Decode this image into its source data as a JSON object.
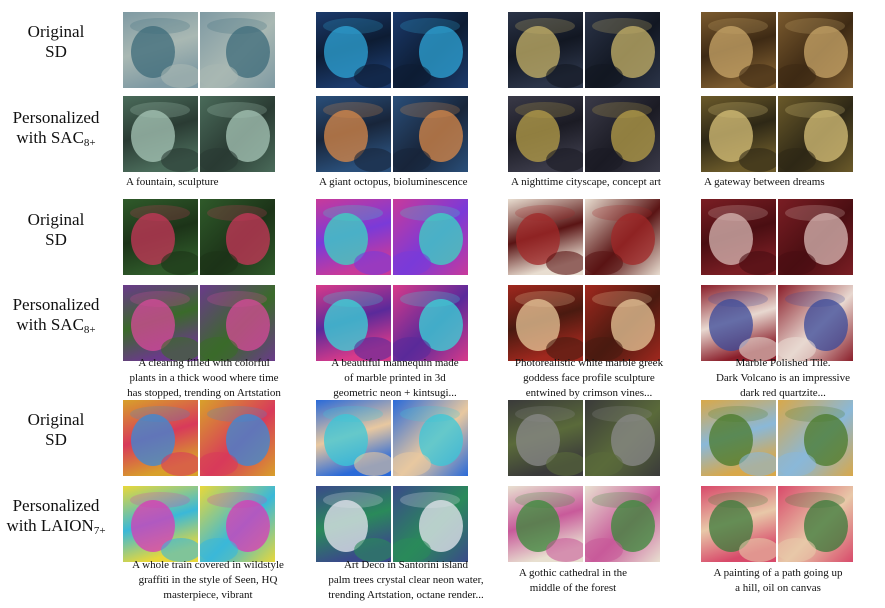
{
  "row_labels": {
    "r1": "Original",
    "r1b": "SD",
    "r2": "Personalized",
    "r2b": "with SAC",
    "r2sub": "8+",
    "r3": "Original",
    "r3b": "SD",
    "r4": "Personalized",
    "r4b": "with SAC",
    "r4sub": "8+",
    "r5": "Original",
    "r5b": "SD",
    "r6": "Personalized",
    "r6b": "with LAION",
    "r6sub": "7+"
  },
  "captions": {
    "g1c1": "A fountain, sculpture",
    "g1c2": "A giant octopus, bioluminescence",
    "g1c3": "A nighttime cityscape, concept art",
    "g1c4": "A gateway between dreams",
    "g2c1": [
      "A clearing filled with colorful",
      "plants in a thick wood where time",
      "has stopped, trending on Artstation"
    ],
    "g2c2": [
      "A beautiful mannequin made",
      "of marble printed in 3d",
      "geometric neon + kintsugi..."
    ],
    "g2c3": [
      "Photorealistic white marble greek",
      "goddess face profile sculpture",
      "entwined by crimson vines..."
    ],
    "g2c4": [
      "Marble Polished Tile.",
      "Dark Volcano is an impressive",
      "dark red quartzite..."
    ],
    "g3c1": [
      "A whole train covered in wildstyle",
      "graffiti in the style of Seen, HQ",
      "masterpiece, vibrant"
    ],
    "g3c2": [
      "Art Deco in Santorini island",
      "palm trees crystal clear neon water,",
      "trending Artstation, octane render..."
    ],
    "g3c3": [
      "A gothic cathedral in the",
      "middle of the forest"
    ],
    "g3c4": [
      "A painting of a path going up",
      "a hill, oil on canvas"
    ]
  },
  "images": [
    {
      "name": "fountain-original",
      "colors": [
        "#7f9aa3",
        "#3d6b7a",
        "#a9b8b3"
      ]
    },
    {
      "name": "octopus-original",
      "colors": [
        "#1b3a6b",
        "#2fa6d8",
        "#0d1c33"
      ]
    },
    {
      "name": "cityscape-original",
      "colors": [
        "#2b3448",
        "#c8b46a",
        "#121722"
      ]
    },
    {
      "name": "gateway-original",
      "colors": [
        "#7a5a2e",
        "#c9a76a",
        "#3e2a14"
      ]
    },
    {
      "name": "fountain-personalized",
      "colors": [
        "#4a6b5a",
        "#a8c7b8",
        "#2a3b33"
      ]
    },
    {
      "name": "octopus-personalized",
      "colors": [
        "#2a4f7a",
        "#d98a4a",
        "#18253a"
      ]
    },
    {
      "name": "cityscape-personalized",
      "colors": [
        "#3a3a48",
        "#b8a04a",
        "#1b1b24"
      ]
    },
    {
      "name": "gateway-personalized",
      "colors": [
        "#6b5a2a",
        "#d8c27a",
        "#2e2816"
      ]
    },
    {
      "name": "clearing-original",
      "colors": [
        "#2f5a2a",
        "#c8375a",
        "#1c3318"
      ]
    },
    {
      "name": "mannequin-original",
      "colors": [
        "#c83a9a",
        "#3ad8c2",
        "#7a3ad8"
      ]
    },
    {
      "name": "marble-goddess-original",
      "colors": [
        "#e8ddd0",
        "#a02828",
        "#5a1414"
      ]
    },
    {
      "name": "tile-original",
      "colors": [
        "#7a1e24",
        "#d8b8b4",
        "#4a0e12"
      ]
    },
    {
      "name": "clearing-personalized",
      "colors": [
        "#6a3a8a",
        "#d84a9a",
        "#3a6a2a"
      ]
    },
    {
      "name": "mannequin-personalized",
      "colors": [
        "#d83a8a",
        "#3ad8d8",
        "#5a2a9a"
      ]
    },
    {
      "name": "marble-goddess-personalized",
      "colors": [
        "#a0281e",
        "#e8c89a",
        "#4a1a10"
      ]
    },
    {
      "name": "tile-personalized",
      "colors": [
        "#8a1e2a",
        "#3a4a9a",
        "#e8d8d0"
      ]
    },
    {
      "name": "train-original",
      "colors": [
        "#d8a02a",
        "#3a8ad8",
        "#d83a5a"
      ]
    },
    {
      "name": "santorini-original",
      "colors": [
        "#2a6ad8",
        "#3ac8d8",
        "#e8c8a0"
      ]
    },
    {
      "name": "cathedral-original",
      "colors": [
        "#3a3a3a",
        "#8a8a8a",
        "#5a6a3a"
      ]
    },
    {
      "name": "path-original",
      "colors": [
        "#d8a84a",
        "#4a7a2a",
        "#8ab8d8"
      ]
    },
    {
      "name": "train-personalized",
      "colors": [
        "#e8d83a",
        "#d83ab8",
        "#3ab8d8"
      ]
    },
    {
      "name": "santorini-personalized",
      "colors": [
        "#3a4a8a",
        "#e8e8f0",
        "#2a8a5a"
      ]
    },
    {
      "name": "cathedral-personalized",
      "colors": [
        "#e8e0d0",
        "#3a8a3a",
        "#c85a9a"
      ]
    },
    {
      "name": "path-personalized",
      "colors": [
        "#d84a6a",
        "#3a7a3a",
        "#e8c8a8"
      ]
    }
  ]
}
